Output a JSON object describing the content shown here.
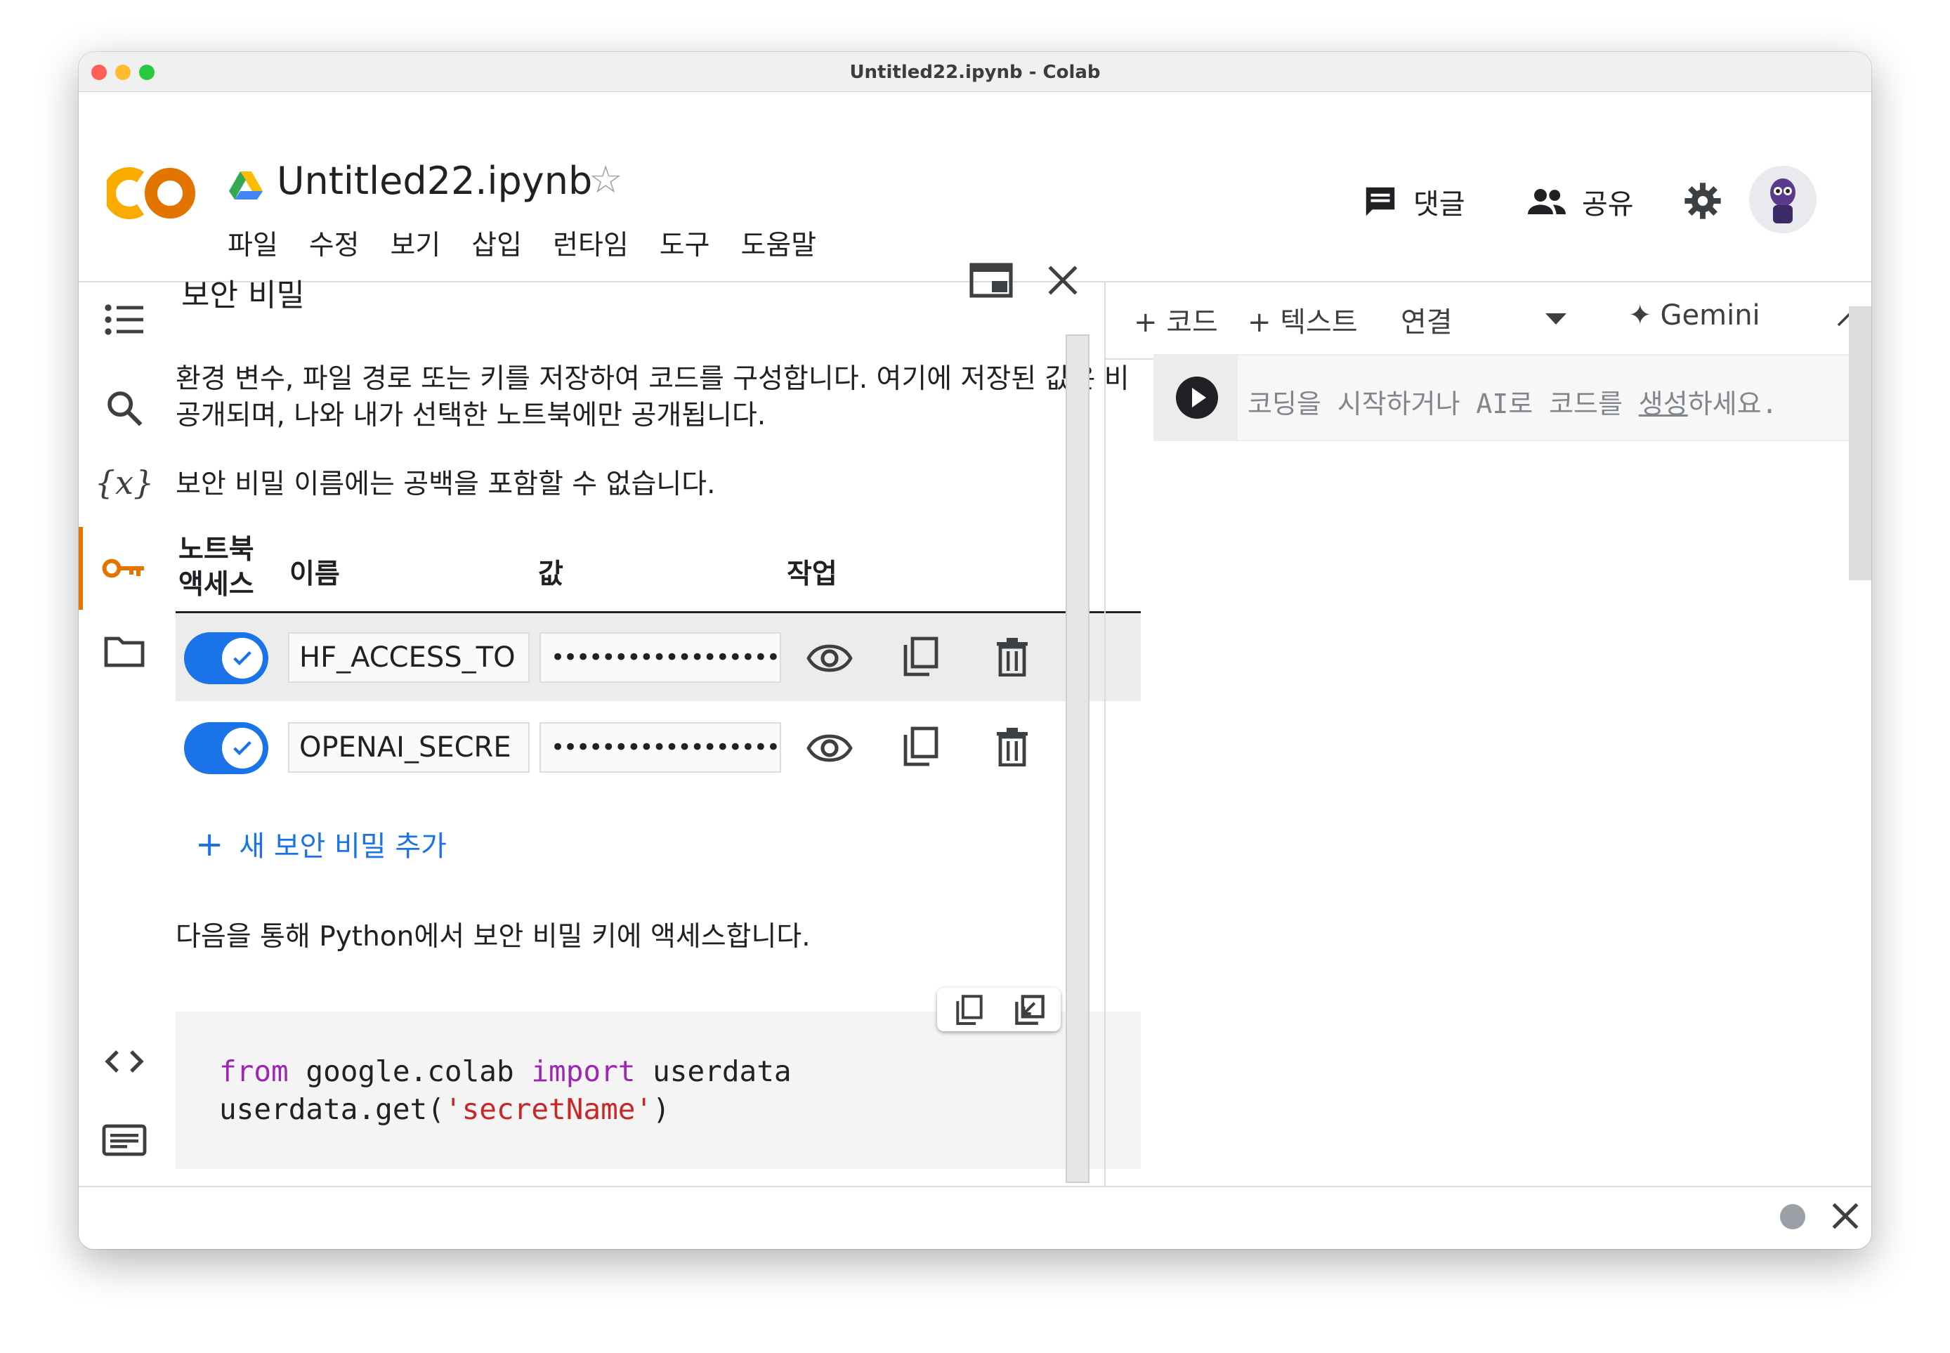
{
  "window": {
    "title": "Untitled22.ipynb - Colab"
  },
  "header": {
    "notebook_title": "Untitled22.ipynb",
    "menu": [
      "파일",
      "수정",
      "보기",
      "삽입",
      "런타임",
      "도구",
      "도움말"
    ],
    "comment_label": "댓글",
    "share_label": "공유"
  },
  "secrets_panel": {
    "title": "보안 비밀",
    "description": "환경 변수, 파일 경로 또는 키를 저장하여 코드를 구성합니다. 여기에 저장된 값은 비공개되며, 나와 내가 선택한 노트북에만 공개됩니다.",
    "name_note": "보안 비밀 이름에는 공백을 포함할 수 없습니다.",
    "columns": {
      "access_line1": "노트북",
      "access_line2": "액세스",
      "name": "이름",
      "value": "값",
      "actions": "작업"
    },
    "secrets": [
      {
        "enabled": true,
        "name": "HF_ACCESS_TO",
        "value": "•••••••••••••••••••••••"
      },
      {
        "enabled": true,
        "name": "OPENAI_SECRE",
        "value": "•••••••••••••••••••••••"
      }
    ],
    "add_label": "새 보안 비밀 추가",
    "access_note": "다음을 통해 Python에서 보안 비밀 키에 액세스합니다.",
    "code": {
      "kw_from": "from",
      "module": " google.colab ",
      "kw_import": "import",
      "name": " userdata",
      "call": "userdata.get(",
      "arg": "'secretName'",
      "close": ")"
    }
  },
  "toolbar": {
    "add_code": "+ 코드",
    "add_text": "+ 텍스트",
    "connect": "연결",
    "gemini": "Gemini"
  },
  "cell": {
    "placeholder_before": "코딩을 시작하거나 AI로 코드를 ",
    "placeholder_link": "생성",
    "placeholder_after": "하세요."
  },
  "colors": {
    "accent_blue": "#1a73e8",
    "active_orange": "#e37400",
    "keyword": "#9c27b0",
    "string": "#c62828"
  }
}
